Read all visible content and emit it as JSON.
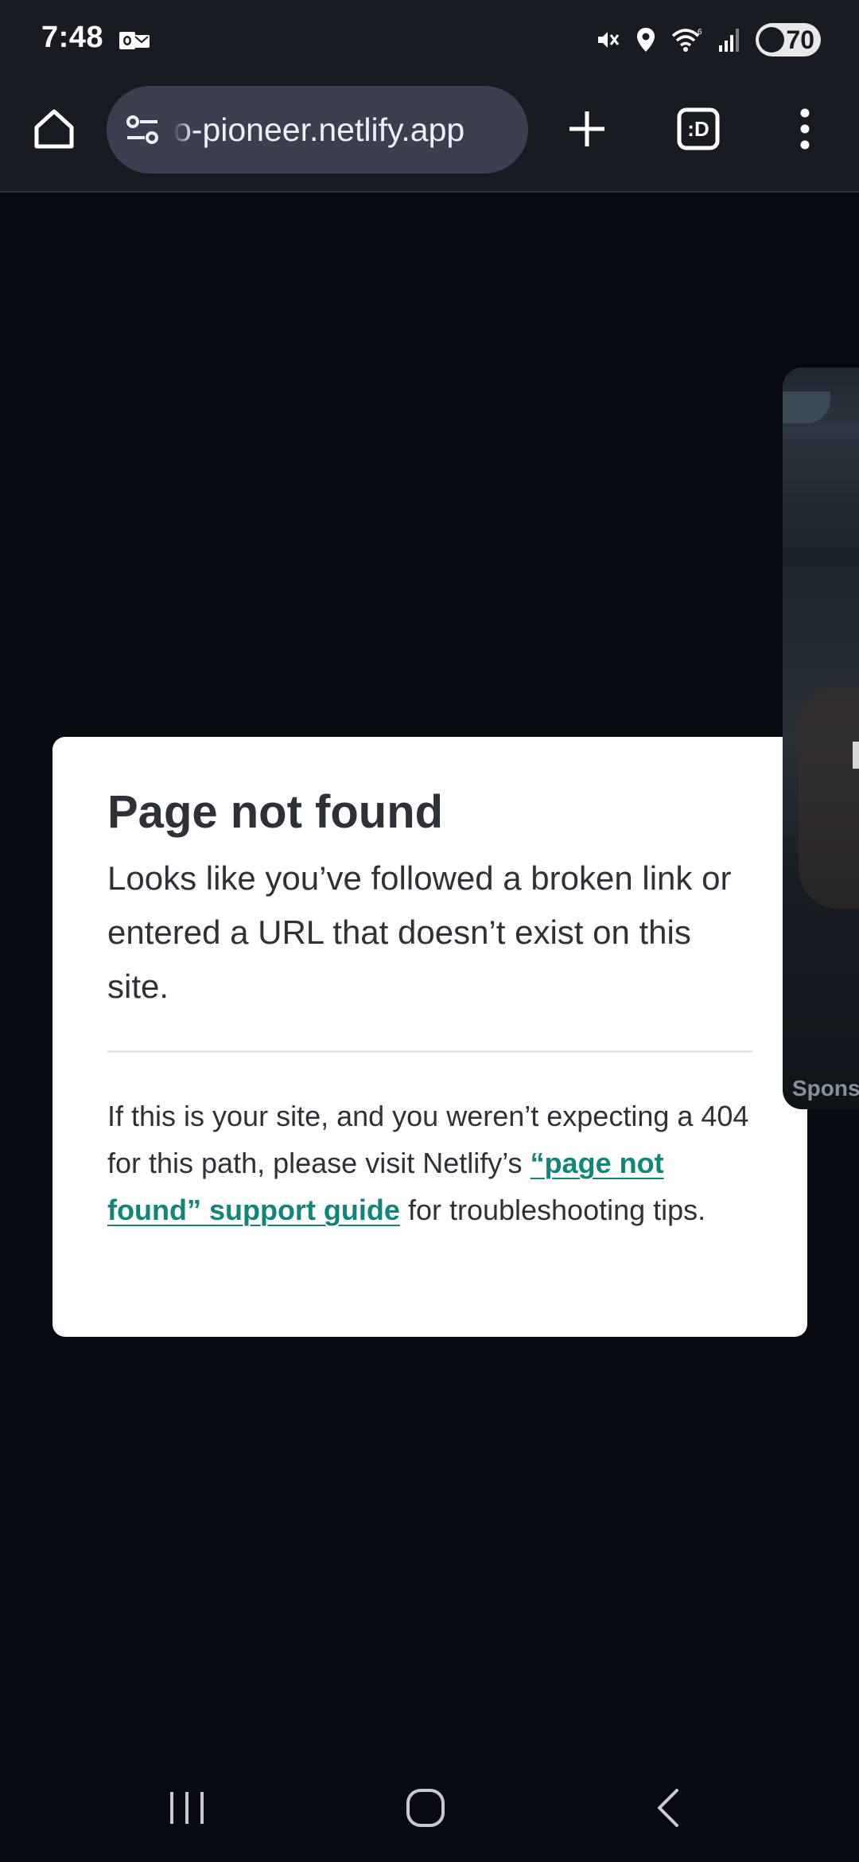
{
  "status_bar": {
    "time": "7:48",
    "battery_level": "70",
    "icons": [
      "outlook-notification-icon",
      "mute-vibrate-icon",
      "location-icon",
      "wifi-icon",
      "signal-icon",
      "battery-icon"
    ]
  },
  "toolbar": {
    "url": "o-pioneer.netlify.app",
    "icons": [
      "home-icon",
      "site-settings-icon",
      "new-tab-icon",
      "tab-switcher-icon",
      "more-menu-icon"
    ],
    "tabs_icon_text": ":D"
  },
  "card": {
    "title": "Page not found",
    "description": "Looks like you’ve followed a broken link or entered a URL that doesn’t exist on this site.",
    "help_before": "If this is your site, and you weren’t expecting a 404 for this path, please visit Netlify’s ",
    "help_link": "“page not found” support guide",
    "help_after": " for troubleshooting tips.",
    "link_color": "#12847a"
  },
  "ad": {
    "label": "Spons"
  },
  "nav_bar": {
    "icons": [
      "recent-apps-icon",
      "home-circle-icon",
      "back-icon"
    ]
  },
  "colors": {
    "page_background": "#070b11",
    "toolbar_background": "#191b22",
    "url_bar_background": "#3b3f4f",
    "card_background": "#ffffff",
    "text_dark": "#2e3238"
  }
}
